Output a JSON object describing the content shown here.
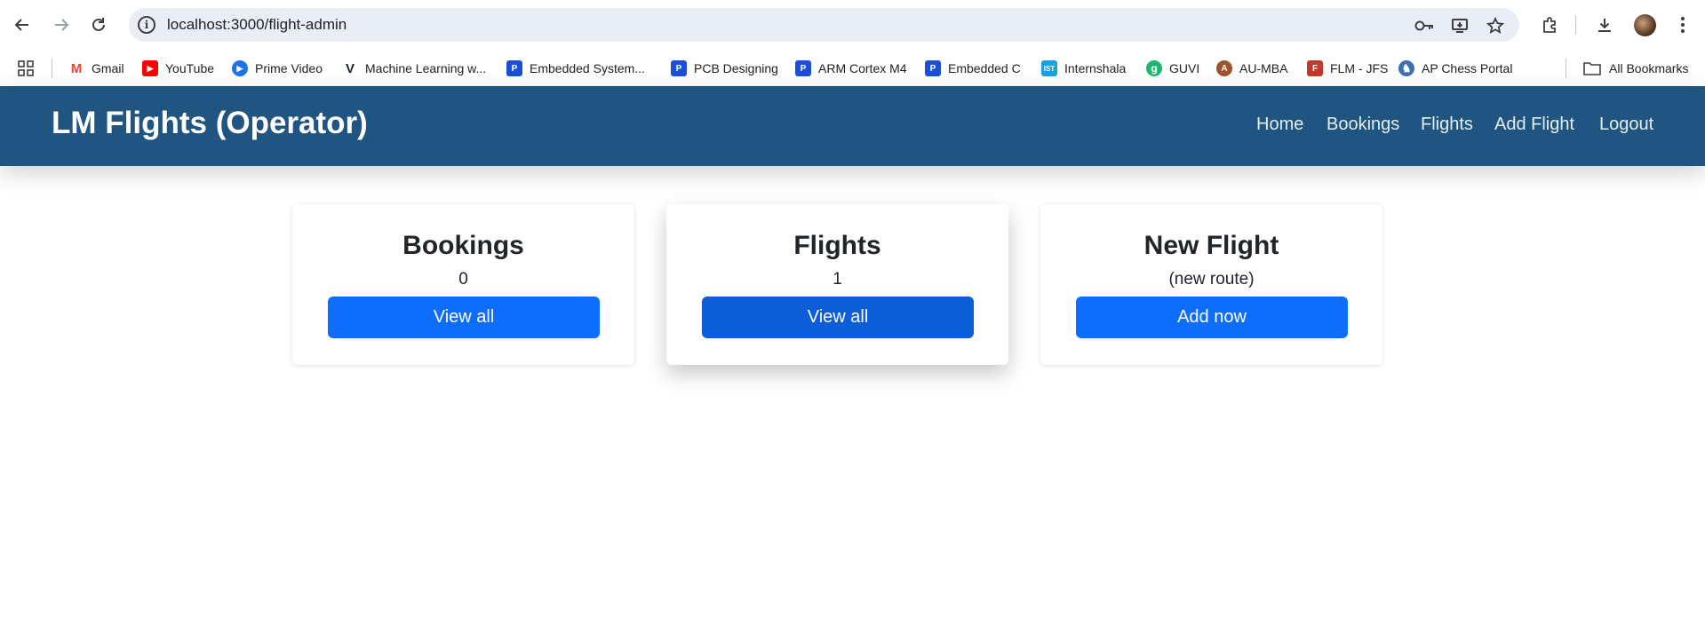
{
  "browser": {
    "url": "localhost:3000/flight-admin",
    "icons": [
      "back-icon",
      "forward-icon",
      "reload-icon",
      "site-info-icon",
      "password-key-icon",
      "install-app-icon",
      "bookmark-star-icon",
      "extensions-icon",
      "downloads-icon",
      "menu-icon"
    ]
  },
  "bookmarks": [
    {
      "label": "Gmail",
      "color": "#ea4335",
      "glyph": "M"
    },
    {
      "label": "YouTube",
      "color": "#ff0000",
      "glyph": "▶"
    },
    {
      "label": "Prime Video",
      "color": "#1a73e8",
      "glyph": "▶"
    },
    {
      "label": "Machine Learning w...",
      "color": "#1b1f3b",
      "glyph": "V"
    },
    {
      "label": "Embedded System...",
      "color": "#1a4fd6",
      "glyph": "P"
    },
    {
      "label": "PCB Designing",
      "color": "#1a4fd6",
      "glyph": "P"
    },
    {
      "label": "ARM Cortex M4",
      "color": "#1a4fd6",
      "glyph": "P"
    },
    {
      "label": "Embedded C",
      "color": "#1a4fd6",
      "glyph": "P"
    },
    {
      "label": "Internshala",
      "color": "#1ba1e2",
      "glyph": "IST"
    },
    {
      "label": "GUVI",
      "color": "#21b573",
      "glyph": "g"
    },
    {
      "label": "AU-MBA",
      "color": "#a0522d",
      "glyph": "A"
    },
    {
      "label": "FLM - JFS",
      "color": "#c0392b",
      "glyph": "F"
    },
    {
      "label": "AP Chess Portal",
      "color": "#3d6fb5",
      "glyph": "♞"
    },
    {
      "label": "All Bookmarks",
      "color": "#5f6368",
      "glyph": "▭"
    }
  ],
  "app": {
    "brand": "LM Flights (Operator)",
    "nav": [
      "Home",
      "Bookings",
      "Flights",
      "Add Flight",
      "Logout"
    ],
    "colors": {
      "navbar": "#1f5580",
      "primary": "#0d6efd"
    }
  },
  "cards": [
    {
      "title": "Bookings",
      "sub": "0",
      "button": "View all"
    },
    {
      "title": "Flights",
      "sub": "1",
      "button": "View all"
    },
    {
      "title": "New Flight",
      "sub": "(new route)",
      "button": "Add now"
    }
  ]
}
